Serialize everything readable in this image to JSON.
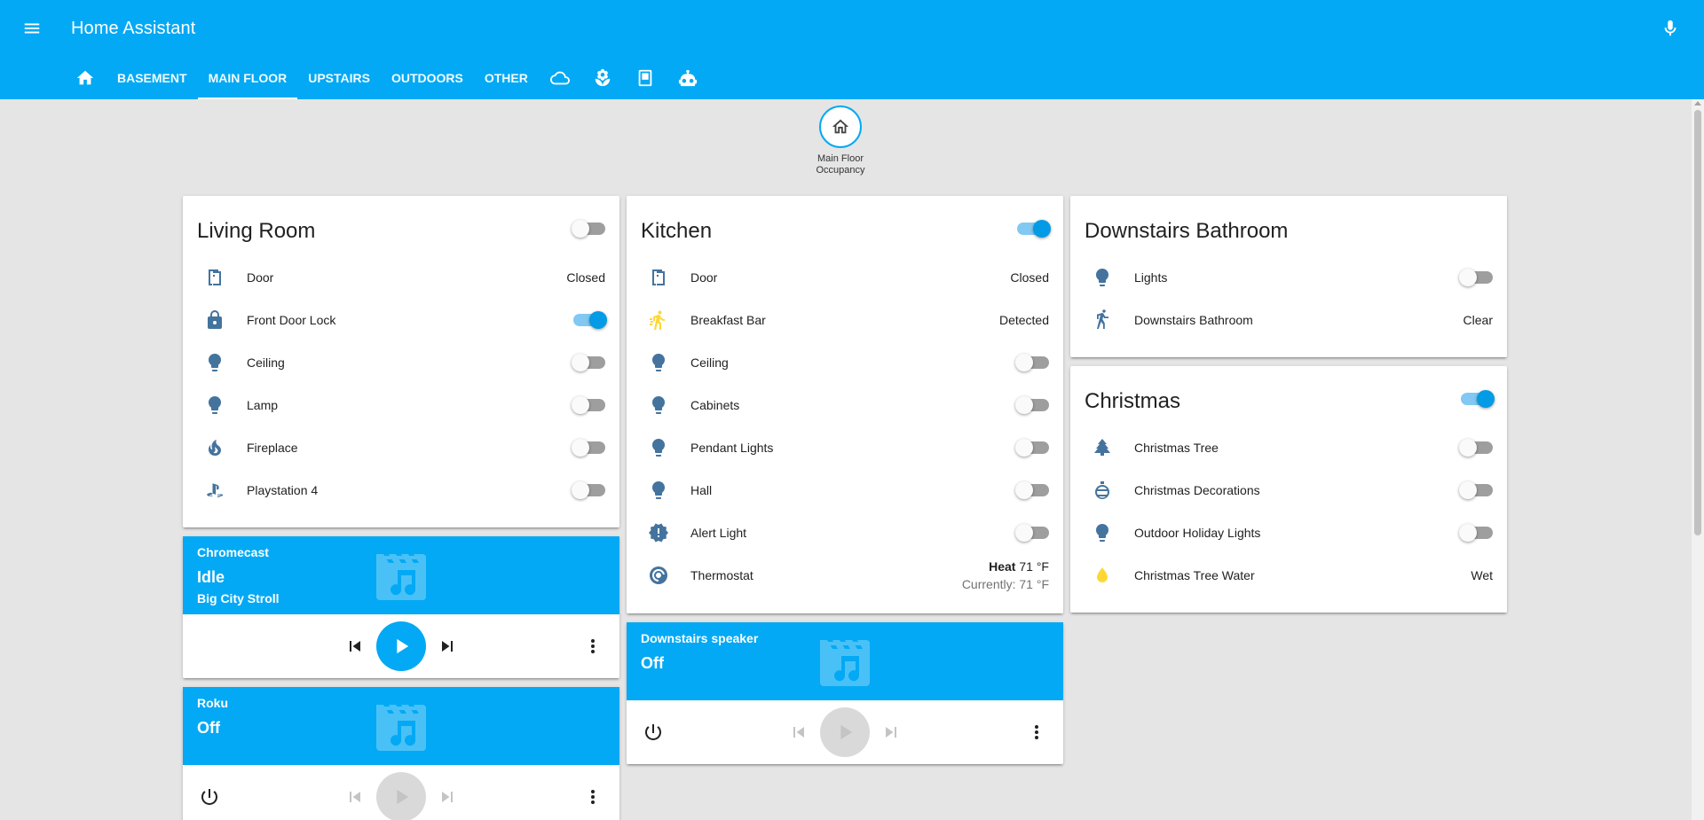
{
  "app": {
    "title": "Home Assistant"
  },
  "tabs": [
    {
      "label": "",
      "icon": "home-icon"
    },
    {
      "label": "BASEMENT"
    },
    {
      "label": "MAIN FLOOR",
      "active": true
    },
    {
      "label": "UPSTAIRS"
    },
    {
      "label": "OUTDOORS"
    },
    {
      "label": "OTHER"
    },
    {
      "label": "",
      "icon": "cloud-icon"
    },
    {
      "label": "",
      "icon": "flower-icon"
    },
    {
      "label": "",
      "icon": "tablet-icon"
    },
    {
      "label": "",
      "icon": "robot-icon"
    }
  ],
  "badge": {
    "label_line1": "Main Floor",
    "label_line2": "Occupancy",
    "icon": "home-outline-icon"
  },
  "living_room": {
    "title": "Living Room",
    "rows": [
      {
        "name": "Door",
        "state": "Closed",
        "icon": "door-icon"
      },
      {
        "name": "Front Door Lock",
        "icon": "lock-icon"
      },
      {
        "name": "Ceiling",
        "icon": "lightbulb-icon"
      },
      {
        "name": "Lamp",
        "icon": "lightbulb-icon"
      },
      {
        "name": "Fireplace",
        "icon": "fire-icon"
      },
      {
        "name": "Playstation 4",
        "icon": "playstation-icon"
      }
    ]
  },
  "kitchen": {
    "title": "Kitchen",
    "rows": [
      {
        "name": "Door",
        "state": "Closed",
        "icon": "door-icon"
      },
      {
        "name": "Breakfast Bar",
        "state": "Detected",
        "icon": "motion-icon"
      },
      {
        "name": "Ceiling",
        "icon": "lightbulb-icon"
      },
      {
        "name": "Cabinets",
        "icon": "lightbulb-icon"
      },
      {
        "name": "Pendant Lights",
        "icon": "lightbulb-icon"
      },
      {
        "name": "Hall",
        "icon": "lightbulb-icon"
      },
      {
        "name": "Alert Light",
        "icon": "alert-decagram-icon"
      },
      {
        "name": "Thermostat",
        "mode": "Heat",
        "temp": "71 °F",
        "current": "Currently: 71 °F",
        "icon": "thermostat-icon"
      }
    ]
  },
  "bathroom": {
    "title": "Downstairs Bathroom",
    "rows": [
      {
        "name": "Lights",
        "icon": "lightbulb-icon"
      },
      {
        "name": "Downstairs Bathroom",
        "state": "Clear",
        "icon": "walk-icon"
      }
    ]
  },
  "christmas": {
    "title": "Christmas",
    "rows": [
      {
        "name": "Christmas Tree",
        "icon": "pine-tree-icon"
      },
      {
        "name": "Christmas Decorations",
        "icon": "ornament-icon"
      },
      {
        "name": "Outdoor Holiday Lights",
        "icon": "lightbulb-icon"
      },
      {
        "name": "Christmas Tree Water",
        "state": "Wet",
        "icon": "water-icon"
      }
    ]
  },
  "chromecast": {
    "name": "Chromecast",
    "state": "Idle",
    "media": "Big City Stroll"
  },
  "roku": {
    "name": "Roku",
    "state": "Off"
  },
  "downstairs_speaker": {
    "name": "Downstairs speaker",
    "state": "Off"
  },
  "colors": {
    "primary": "#03a9f4",
    "icon": "#44739e",
    "toggle_on": "#039be5",
    "active_yellow": "#fdd835"
  }
}
